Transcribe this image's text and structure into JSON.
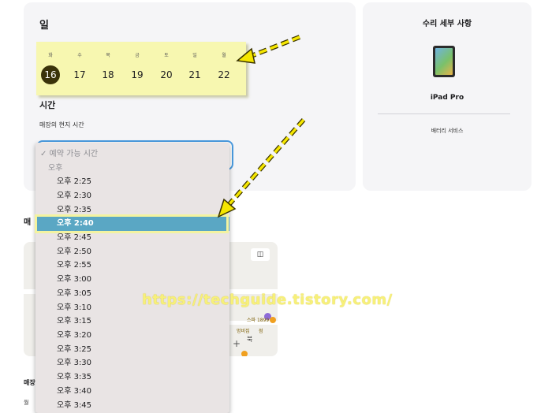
{
  "schedule": {
    "day_title": "일",
    "days": [
      {
        "dow": "화",
        "date": "16",
        "selected": true
      },
      {
        "dow": "수",
        "date": "17",
        "selected": false
      },
      {
        "dow": "목",
        "date": "18",
        "selected": false
      },
      {
        "dow": "금",
        "date": "19",
        "selected": false
      },
      {
        "dow": "토",
        "date": "20",
        "selected": false
      },
      {
        "dow": "일",
        "date": "21",
        "selected": false
      },
      {
        "dow": "월",
        "date": "22",
        "selected": false
      }
    ],
    "time_title": "시간",
    "time_subtitle": "매장의 현지 시간"
  },
  "dropdown": {
    "header": "✓ 예약 가능 시간",
    "group": "오후",
    "selected": "오후 2:40",
    "options": [
      "오후 2:25",
      "오후 2:30",
      "오후 2:35",
      "오후 2:40",
      "오후 2:45",
      "오후 2:50",
      "오후 2:55",
      "오후 3:00",
      "오후 3:05",
      "오후 3:10",
      "오후 3:15",
      "오후 3:20",
      "오후 3:25",
      "오후 3:30",
      "오후 3:35",
      "오후 3:40",
      "오후 3:45"
    ]
  },
  "repair": {
    "title": "수리 세부 사항",
    "device": "iPad Pro",
    "service": "배터리 서비스"
  },
  "store": {
    "section_partial": "매",
    "bottom_label_a": "매장",
    "bottom_label_b": "월",
    "map_labels": [
      "스파 1899",
      "멍비집",
      "북",
      "점"
    ],
    "map_button_icon": "map-icon"
  },
  "watermark": "https://techguide.tistory.com/",
  "colors": {
    "highlight": "#f7f7b0",
    "selected_date": "#3a330a",
    "selected_option": "#5aa7c4",
    "focus_border": "#4a9be0",
    "arrow": "#f5e600"
  }
}
